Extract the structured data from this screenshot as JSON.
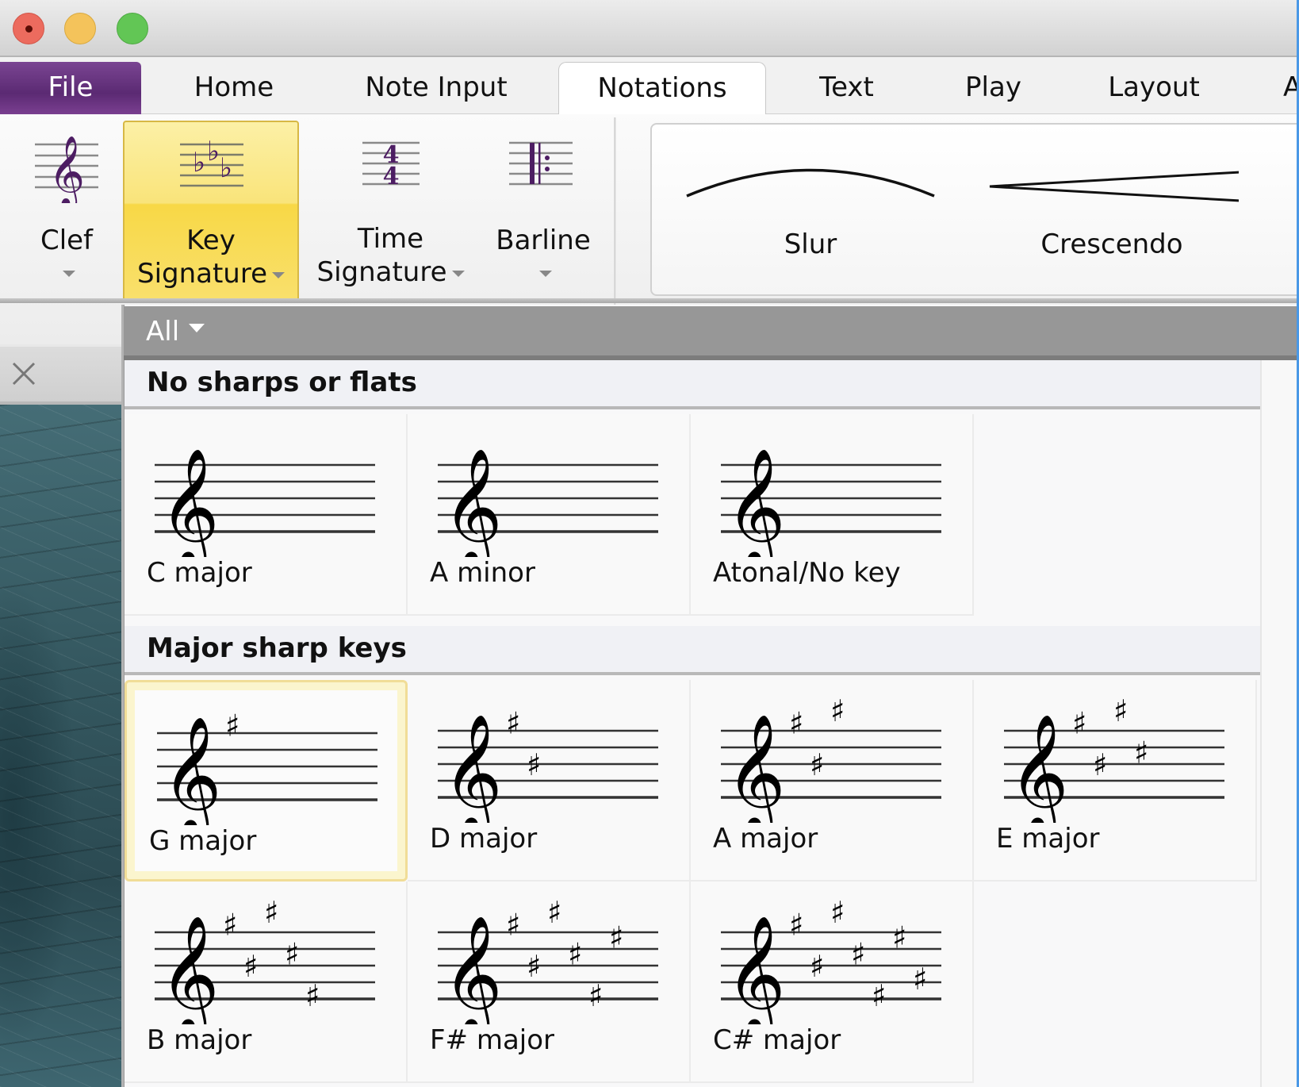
{
  "window": {
    "traffic_lights": [
      "close",
      "minimize",
      "zoom"
    ]
  },
  "tabs": [
    {
      "label": "File",
      "kind": "file"
    },
    {
      "label": "Home"
    },
    {
      "label": "Note Input"
    },
    {
      "label": "Notations",
      "active": true
    },
    {
      "label": "Text"
    },
    {
      "label": "Play"
    },
    {
      "label": "Layout"
    },
    {
      "label": "A"
    }
  ],
  "ribbon": {
    "buttons": [
      {
        "id": "clef",
        "line1": "Clef",
        "line2": "",
        "icon": "treble-clef-icon",
        "has_dropdown": true
      },
      {
        "id": "key-signature",
        "line1": "Key",
        "line2": "Signature",
        "icon": "key-signature-flats-icon",
        "has_dropdown": true,
        "selected": true
      },
      {
        "id": "time-signature",
        "line1": "Time",
        "line2": "Signature",
        "icon": "time-signature-4-4-icon",
        "has_dropdown": true
      },
      {
        "id": "barline",
        "line1": "Barline",
        "line2": "",
        "icon": "repeat-barline-icon",
        "has_dropdown": true
      }
    ],
    "gallery": [
      {
        "label": "Slur",
        "icon": "slur-icon"
      },
      {
        "label": "Crescendo",
        "icon": "crescendo-hairpin-icon"
      }
    ]
  },
  "document": {
    "close_icon": "close-icon"
  },
  "panel": {
    "filter": "All",
    "colors": {
      "header": "#979797",
      "selected_border": "#f1dd97",
      "accent_purple": "#5b2a73"
    },
    "sections": [
      {
        "title": "No sharps or flats",
        "items": [
          {
            "name": "C major",
            "sharps": 0
          },
          {
            "name": "A minor",
            "sharps": 0
          },
          {
            "name": "Atonal/No key",
            "sharps": 0
          }
        ]
      },
      {
        "title": "Major sharp keys",
        "items": [
          {
            "name": "G major",
            "sharps": 1,
            "selected": true
          },
          {
            "name": "D major",
            "sharps": 2
          },
          {
            "name": "A major",
            "sharps": 3
          },
          {
            "name": "E major",
            "sharps": 4
          },
          {
            "name": "B major",
            "sharps": 5
          },
          {
            "name": "F# major",
            "sharps": 6
          },
          {
            "name": "C# major",
            "sharps": 7
          }
        ]
      }
    ]
  }
}
